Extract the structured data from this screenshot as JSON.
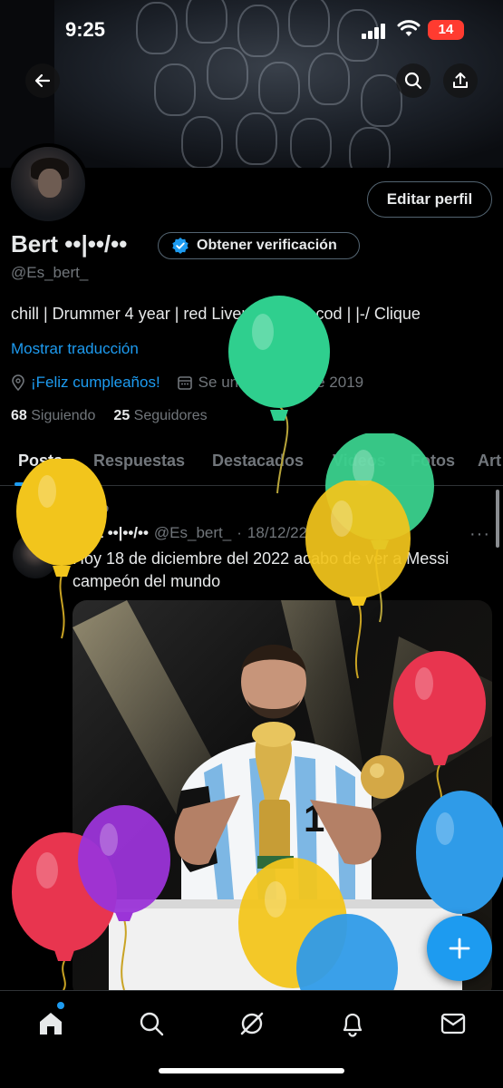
{
  "status_bar": {
    "time": "9:25",
    "battery": "14"
  },
  "profile": {
    "display_name": "Bert ••|••/••",
    "verify_label": "Obtener verificación",
    "handle": "@Es_bert_",
    "bio": "chill | Drummer 4 year | red Liverpool ⚽ | cod | |-/ Clique",
    "translate_label": "Mostrar traducción",
    "birthday_label": "¡Feliz cumpleaños!",
    "joined": "Se unió en julio de 2019",
    "following_count": "68",
    "following_label": "Siguiendo",
    "followers_count": "25",
    "followers_label": "Seguidores",
    "edit_label": "Editar perfil"
  },
  "tabs": [
    "Posts",
    "Respuestas",
    "Destacados",
    "Videos",
    "Fotos",
    "Art"
  ],
  "post": {
    "pinned_label": "Fijado",
    "author_name": "Bert ••|••/••",
    "author_handle": "@Es_bert_",
    "separator": "·",
    "date": "18/12/22",
    "more": "···",
    "text": "Hoy 18 de diciembre del 2022 acabo de ver a Messi campeón del mundo"
  },
  "colors": {
    "accent": "#1d9bf0",
    "balloon_green": "#2fcf8e",
    "balloon_yellow": "#f2c51c",
    "balloon_red": "#e8354f",
    "balloon_purple": "#9b34d8",
    "balloon_blue": "#2f9be8"
  },
  "icons": {
    "header": [
      "back-arrow-icon",
      "search-icon",
      "share-icon"
    ],
    "nav": [
      "home-icon",
      "search-icon",
      "grok-icon",
      "bell-icon",
      "mail-icon"
    ],
    "fab": "plus-icon"
  }
}
